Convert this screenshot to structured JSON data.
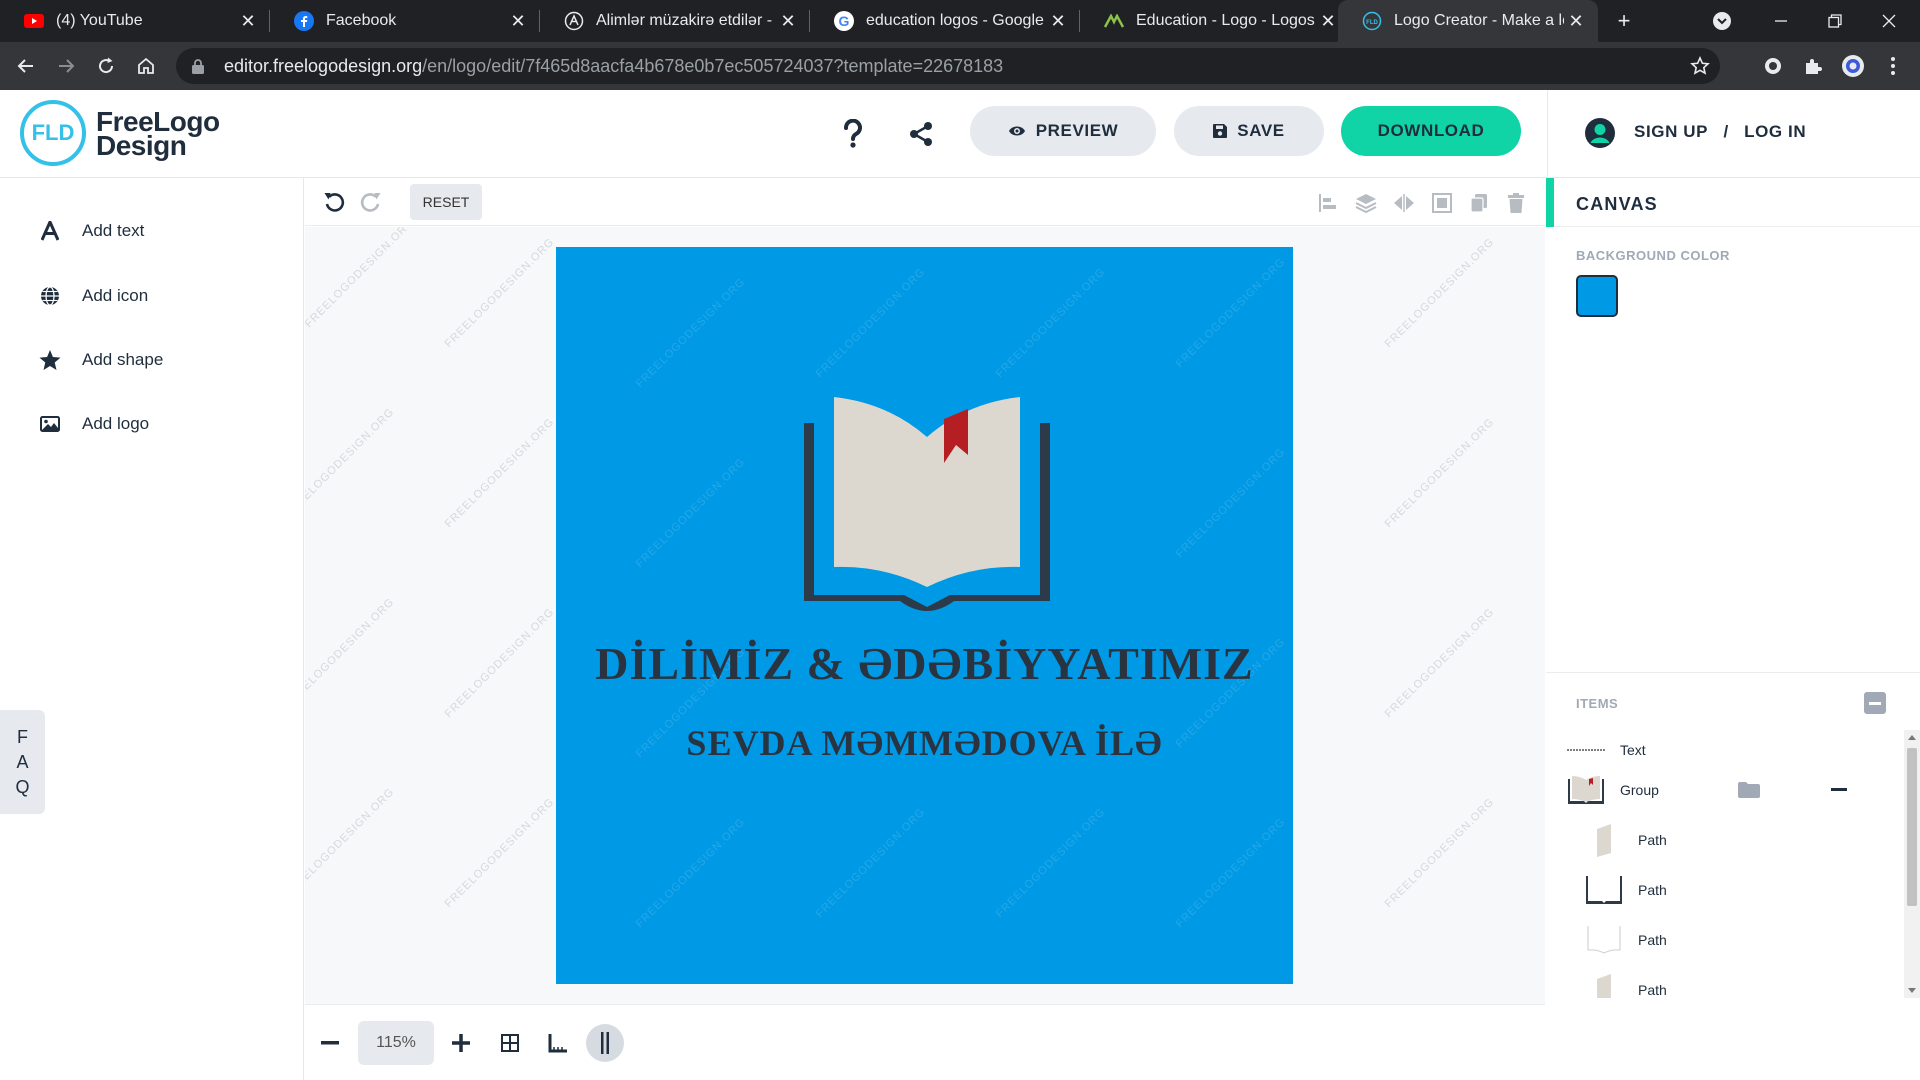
{
  "browser": {
    "tabs": [
      {
        "title": "(4) YouTube",
        "icon": "youtube-icon"
      },
      {
        "title": "Facebook",
        "icon": "facebook-icon"
      },
      {
        "title": "Alimlər müzakirə etdilər - \"Ana",
        "icon": "circle-a-icon"
      },
      {
        "title": "education logos - Google Search",
        "icon": "google-icon"
      },
      {
        "title": "Education - Logo - Logos & Brands",
        "icon": "logomaker-icon"
      },
      {
        "title": "Logo Creator - Make a logo",
        "icon": "fld-favicon-icon"
      }
    ],
    "new_tab": "+",
    "url_host": "editor.freelogodesign.org",
    "url_path": "/en/logo/edit/7f465d8aacfa4b678e0b7ec505724037?template=22678183"
  },
  "header": {
    "logo_mark": "FLD",
    "logo_line1": "FreeLogo",
    "logo_line2": "Design",
    "preview_label": "PREVIEW",
    "save_label": "SAVE",
    "download_label": "DOWNLOAD",
    "signup_label": "SIGN UP",
    "auth_separator": "/",
    "login_label": "LOG IN"
  },
  "sidebar": {
    "items": [
      {
        "label": "Add text",
        "icon": "text-a-icon"
      },
      {
        "label": "Add icon",
        "icon": "globe-icon"
      },
      {
        "label": "Add shape",
        "icon": "star-icon"
      },
      {
        "label": "Add logo",
        "icon": "image-icon"
      }
    ],
    "faq": [
      "F",
      "A",
      "Q"
    ]
  },
  "editor": {
    "reset_label": "RESET",
    "watermark": "FREELOGODESIGN.ORG",
    "zoom": "115%"
  },
  "logo": {
    "title": "DİLİMİZ & ƏDƏBİYYATIMIZ",
    "subtitle": "SEVDA MƏMMƏDOVA İLƏ",
    "background_color": "#0099e5",
    "text_color": "#2a3340",
    "bookmark_color": "#b51f24"
  },
  "right_panel": {
    "canvas_title": "CANVAS",
    "background_label": "BACKGROUND COLOR",
    "items_label": "ITEMS",
    "items": [
      {
        "label": "Text"
      },
      {
        "label": "Group"
      },
      {
        "label": "Path"
      },
      {
        "label": "Path"
      },
      {
        "label": "Path"
      },
      {
        "label": "Path"
      }
    ]
  },
  "colors": {
    "accent_green": "#11d4a6",
    "logo_blue": "#35c0e8",
    "dark_text": "#1f2d3d"
  }
}
